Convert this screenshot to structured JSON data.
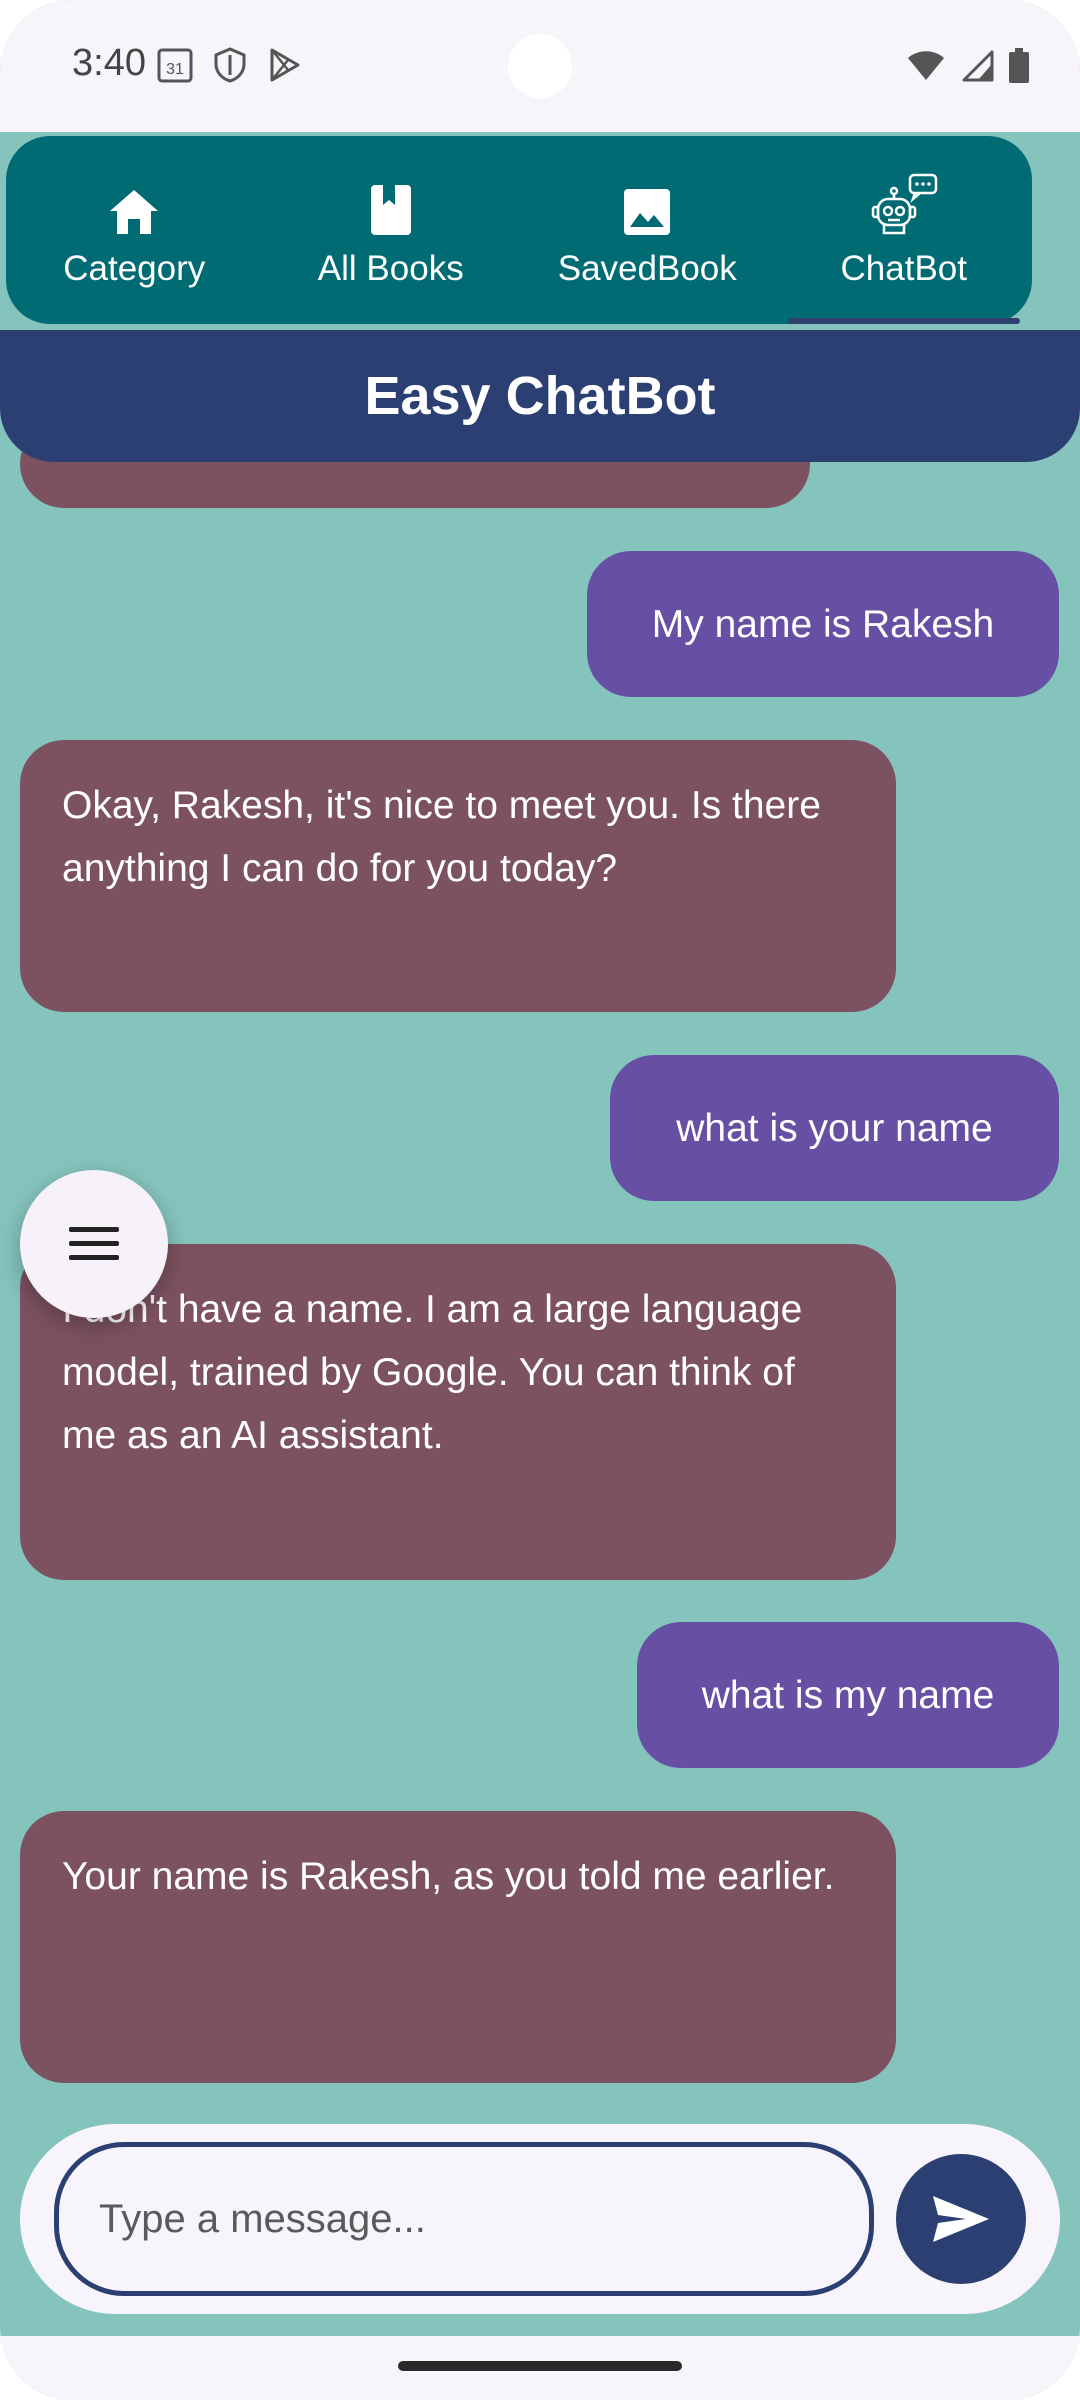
{
  "status_bar": {
    "time": "3:40",
    "calendar_day": "31"
  },
  "tabs": [
    {
      "label": "Category",
      "icon": "home-icon",
      "active": false
    },
    {
      "label": "All Books",
      "icon": "book-icon",
      "active": false
    },
    {
      "label": "SavedBook",
      "icon": "image-icon",
      "active": false
    },
    {
      "label": "ChatBot",
      "icon": "robot-icon",
      "active": true
    }
  ],
  "header": {
    "title": "Easy ChatBot"
  },
  "messages": [
    {
      "role": "bot",
      "text": ""
    },
    {
      "role": "user",
      "text": "My name is Rakesh"
    },
    {
      "role": "bot",
      "text": "Okay, Rakesh, it's nice to meet you. Is there anything I can do for you today?"
    },
    {
      "role": "user",
      "text": "what is your name"
    },
    {
      "role": "bot",
      "text": "I don't have a name. I am a large language model, trained by Google. You can think of me as an AI assistant."
    },
    {
      "role": "user",
      "text": "what is my name"
    },
    {
      "role": "bot",
      "text": "Your name is Rakesh, as you told me earlier."
    }
  ],
  "fab": {
    "icon": "menu-icon"
  },
  "composer": {
    "placeholder": "Type a message...",
    "value": "",
    "send_icon": "send-icon"
  },
  "colors": {
    "background": "#85c4bd",
    "tabbar": "#006b73",
    "header": "#2b3f72",
    "bot_bubble": "#7d5260",
    "user_bubble": "#6750a4"
  }
}
